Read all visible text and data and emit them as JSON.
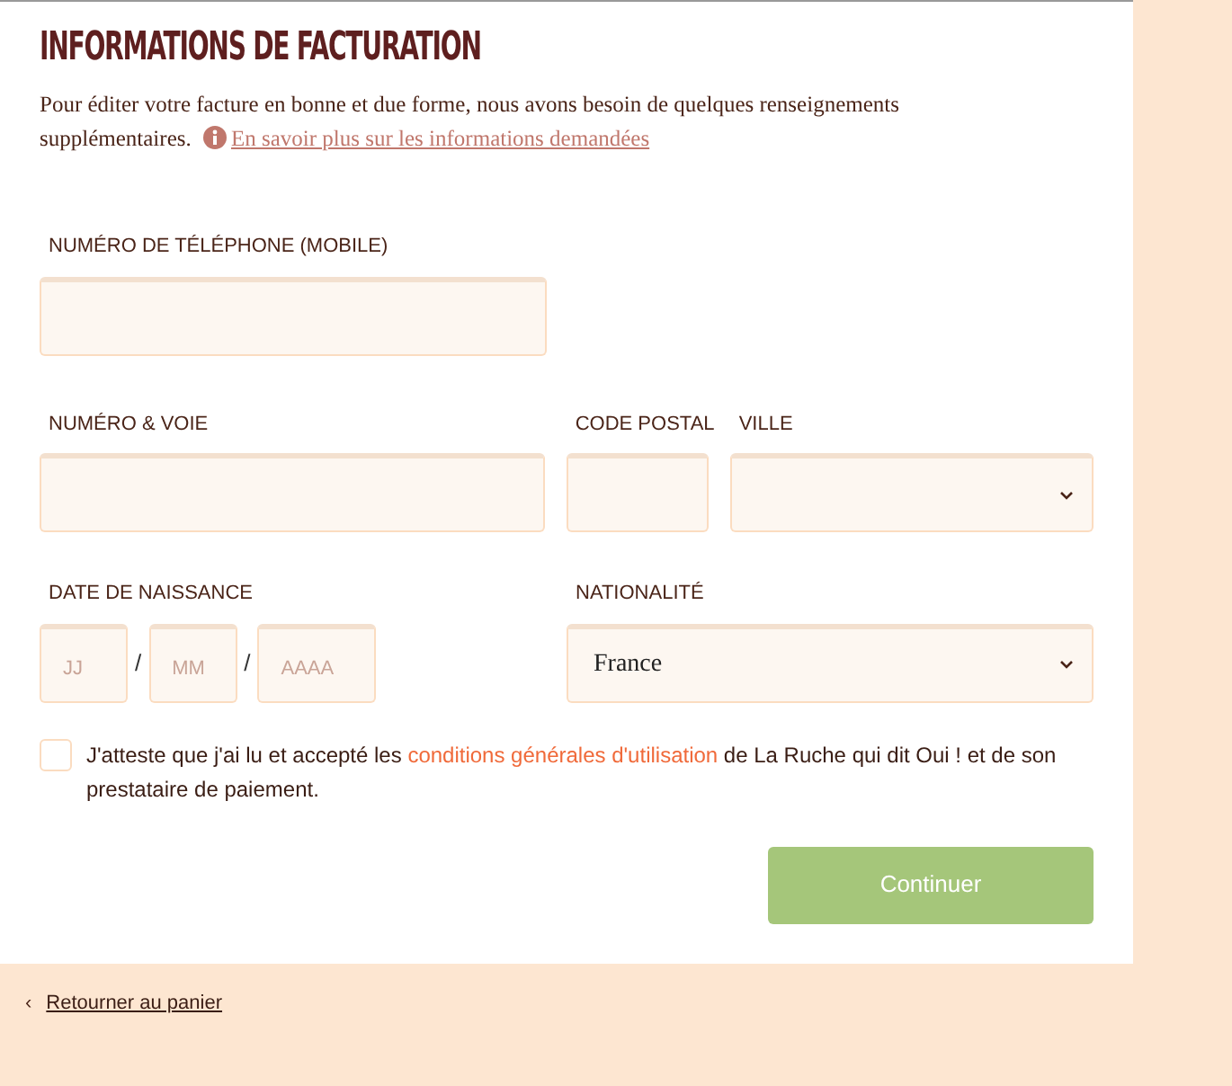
{
  "title": "INFORMATIONS DE FACTURATION",
  "intro": {
    "text": "Pour éditer votre facture en bonne et due forme, nous avons besoin de quelques renseignements supplémentaires.",
    "link": "En savoir plus sur les informations demandées"
  },
  "phone": {
    "label": "NUMÉRO DE TÉLÉPHONE (MOBILE)"
  },
  "address": {
    "street_label": "NUMÉRO & VOIE",
    "postal_label": "CODE POSTAL",
    "city_label": "VILLE"
  },
  "birth": {
    "label": "DATE DE NAISSANCE",
    "parts": [
      {
        "placeholder": "JJ"
      },
      {
        "placeholder": "MM"
      },
      {
        "placeholder": "AAAA"
      }
    ],
    "separators": [
      "/",
      "/"
    ]
  },
  "nationality": {
    "label": "NATIONALITÉ",
    "value": "France"
  },
  "consent": {
    "checked": false,
    "before": "J'atteste que j'ai lu et accepté les",
    "link": "conditions générales d'utilisation",
    "after": "de La Ruche qui dit Oui ! et de son prestataire de paiement."
  },
  "submit": "Continuer",
  "back": {
    "arrow": "‹",
    "label": "Retourner au panier"
  }
}
